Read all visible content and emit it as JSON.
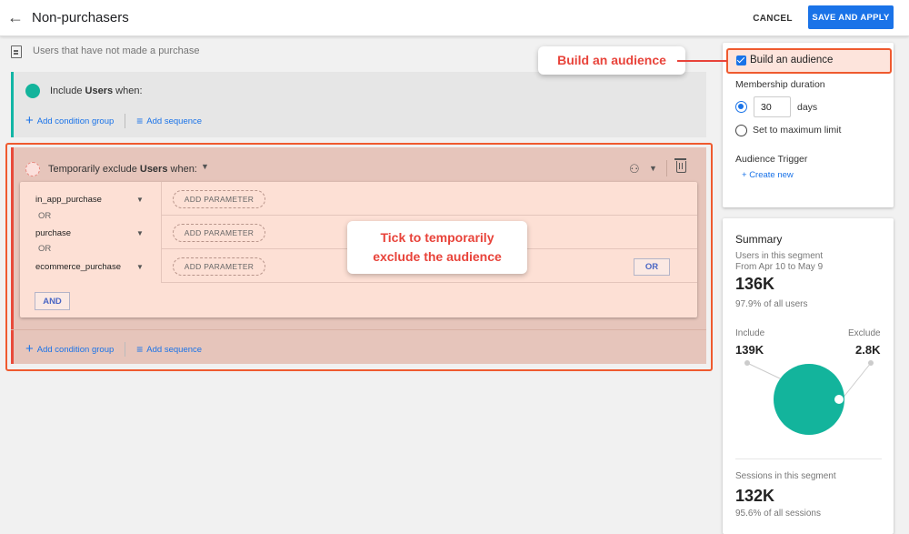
{
  "header": {
    "title": "Non-purchasers",
    "cancel_label": "CANCEL",
    "save_label": "SAVE AND APPLY"
  },
  "description": "Users that have not made a purchase",
  "include_group": {
    "prefix": "Include ",
    "scope": "Users",
    "suffix": " when:",
    "add_condition_group": "Add condition group",
    "add_sequence": "Add sequence",
    "accent": "#12b5a5"
  },
  "exclude_group": {
    "prefix": "Temporarily exclude ",
    "scope": "Users",
    "suffix": " when:",
    "conditions": [
      {
        "event": "in_app_purchase",
        "param_label": "ADD PARAMETER"
      },
      {
        "event": "purchase",
        "param_label": "ADD PARAMETER"
      },
      {
        "event": "ecommerce_purchase",
        "param_label": "ADD PARAMETER"
      }
    ],
    "or_separator": "OR",
    "or_button": "OR",
    "and_button": "AND",
    "add_condition_group": "Add condition group",
    "add_sequence": "Add sequence",
    "accent": "#e84a3a"
  },
  "callouts": {
    "build": "Build an audience",
    "tick_line1": "Tick to temporarily",
    "tick_line2": "exclude the audience"
  },
  "settings": {
    "build_audience_label": "Build an audience",
    "build_audience_checked": true,
    "membership_label": "Membership duration",
    "days_value": "30",
    "days_unit": "days",
    "max_limit_label": "Set to maximum limit",
    "trigger_label": "Audience Trigger",
    "create_new": "Create new"
  },
  "summary": {
    "title": "Summary",
    "users_label": "Users in this segment",
    "date_range": "From Apr 10 to May 9",
    "users_value": "136K",
    "users_pct": "97.9% of all users",
    "include_label": "Include",
    "include_value": "139K",
    "exclude_label": "Exclude",
    "exclude_value": "2.8K",
    "sessions_label": "Sessions in this segment",
    "sessions_value": "132K",
    "sessions_pct": "95.6% of all sessions",
    "donut_color": "#13b49c"
  },
  "colors": {
    "primary": "#1a73e8",
    "callout_red": "#e8433a",
    "highlight_outline": "#ef5a2f"
  }
}
